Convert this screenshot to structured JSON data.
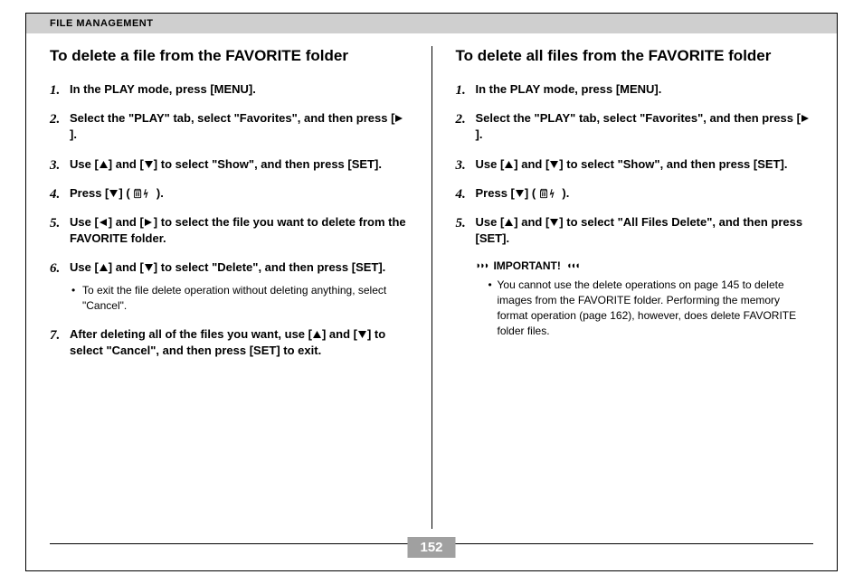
{
  "header": "FILE MANAGEMENT",
  "page_number": "152",
  "left": {
    "heading": "To delete a file from the FAVORITE folder",
    "steps": [
      {
        "text": "In the PLAY mode, press [MENU]."
      },
      {
        "text_parts": [
          "Select the \"PLAY\" tab, select \"Favorites\", and then press [",
          "RIGHT",
          "]."
        ]
      },
      {
        "text_parts": [
          "Use [",
          "UP",
          "] and [",
          "DOWN",
          "] to select \"Show\", and then press [SET]."
        ]
      },
      {
        "text_parts": [
          "Press [",
          "DOWN",
          "] ( ",
          "TRASH_FLASH",
          " )."
        ]
      },
      {
        "text_parts": [
          "Use [",
          "LEFT",
          "] and [",
          "RIGHT",
          "] to select the file you want to delete from the FAVORITE folder."
        ]
      },
      {
        "text_parts": [
          "Use [",
          "UP",
          "] and [",
          "DOWN",
          "] to select \"Delete\", and then press [SET]."
        ],
        "sub": "To exit the file delete operation without deleting anything, select \"Cancel\"."
      },
      {
        "text_parts": [
          "After deleting all of the files you want, use [",
          "UP",
          "] and [",
          "DOWN",
          "] to select \"Cancel\", and then press [SET] to exit."
        ]
      }
    ]
  },
  "right": {
    "heading": "To delete all files from the FAVORITE folder",
    "steps": [
      {
        "text": "In the PLAY mode, press [MENU]."
      },
      {
        "text_parts": [
          "Select the \"PLAY\" tab, select \"Favorites\", and then press [",
          "RIGHT",
          "]."
        ]
      },
      {
        "text_parts": [
          "Use [",
          "UP",
          "] and [",
          "DOWN",
          "] to select \"Show\", and then press [SET]."
        ]
      },
      {
        "text_parts": [
          "Press [",
          "DOWN",
          "] ( ",
          "TRASH_FLASH",
          " )."
        ]
      },
      {
        "text_parts": [
          "Use [",
          "UP",
          "] and [",
          "DOWN",
          "] to select \"All Files Delete\", and then press [SET]."
        ]
      }
    ],
    "important_label": "IMPORTANT!",
    "important_note": "You cannot use the delete operations on page 145 to delete images from the FAVORITE folder. Performing the memory format operation (page 162), however, does delete FAVORITE folder files."
  }
}
